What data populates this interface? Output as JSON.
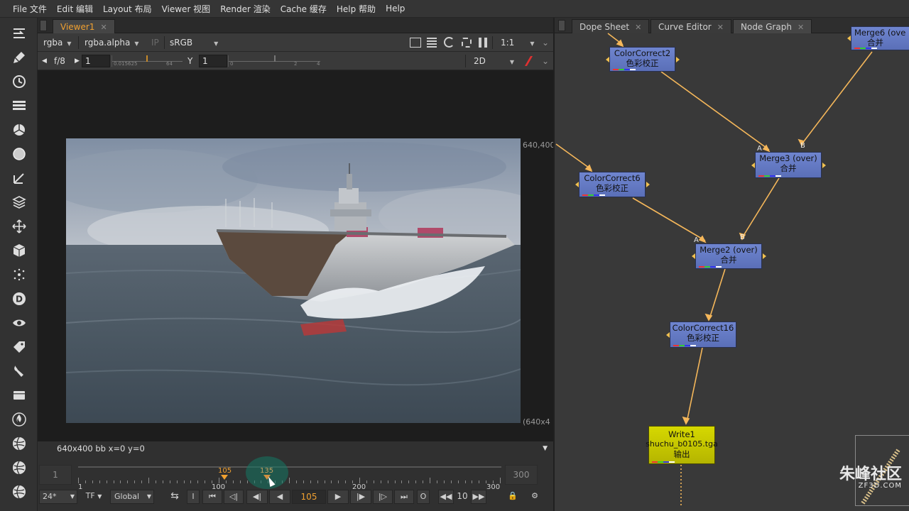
{
  "menu": [
    "File 文件",
    "Edit 编辑",
    "Layout 布局",
    "Viewer 视图",
    "Render 渲染",
    "Cache 缓存",
    "Help 帮助",
    "Help"
  ],
  "viewer": {
    "tab_label": "Viewer1",
    "channels": "rgba",
    "alpha_channel": "rgba.alpha",
    "ip_label": "IP",
    "colorspace": "sRGB",
    "zoom": "1:1",
    "fstop": "f/8",
    "gain_value": "1",
    "gain_ticks": [
      "0.015625",
      "1",
      "64"
    ],
    "gamma_label": "Y",
    "gamma_value": "1",
    "gamma_ticks": [
      "0",
      "1",
      "2",
      "4"
    ],
    "view_mode": "2D",
    "format_top_right": "640,400",
    "format_bottom_right": "(640x4",
    "info": "640x400  bb  x=0 y=0"
  },
  "timeline": {
    "start": "1",
    "end": "300",
    "current_frame_marker": "105",
    "hover_frame": "135",
    "ticks": [
      "1",
      "100",
      "200",
      "300"
    ],
    "fps": "24*",
    "mode": "TF",
    "range": "Global",
    "frame_field": "105",
    "increment": "10",
    "in_label": "I",
    "out_label": "O"
  },
  "nodepanel": {
    "tabs": [
      "Dope Sheet",
      "Curve Editor",
      "Node Graph"
    ],
    "nodes": [
      {
        "name": "ColorCorrect2",
        "sub": "色彩校正"
      },
      {
        "name": "Merge3 (over)",
        "sub": "合并"
      },
      {
        "name": "ColorCorrect6",
        "sub": "色彩校正"
      },
      {
        "name": "Merge2 (over)",
        "sub": "合并"
      },
      {
        "name": "ColorCorrect16",
        "sub": "色彩校正"
      },
      {
        "name": "Write1",
        "sub": "shuchu_b0105.tga",
        "sub2": "输出"
      },
      {
        "name": "Merge6 (ove",
        "sub": "合并"
      }
    ],
    "input_labels": [
      "A",
      "B",
      "A",
      "B"
    ]
  },
  "watermark": {
    "brand": "朱峰社区",
    "url": "ZF3D.COM"
  },
  "colors": {
    "accent": "#f0a030",
    "node_blue": "#6478c4",
    "node_write": "#c8c800",
    "pipe": "#f5b75a"
  }
}
